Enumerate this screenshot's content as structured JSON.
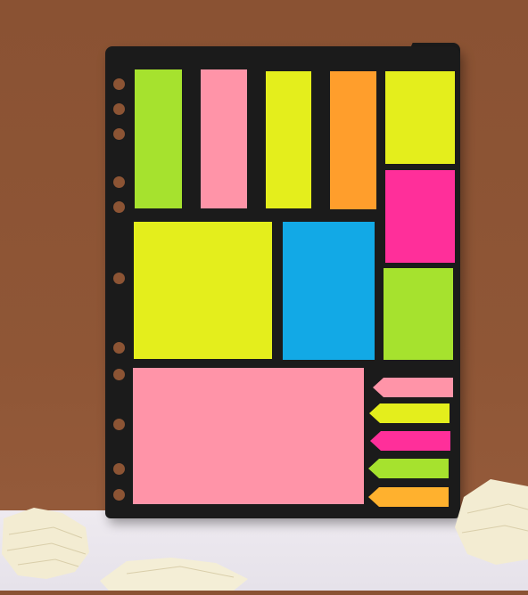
{
  "scene": {
    "subject": "sticky-notes-set",
    "colors": {
      "wall": "#8a5233",
      "table": "#ece8ee",
      "board": "#1b1b1b",
      "green": "#a6e22e",
      "pink": "#ff94a8",
      "yellow": "#e4ee1c",
      "orange": "#ff9e2c",
      "magenta": "#ff2f9a",
      "blue": "#12a9e6",
      "paper": "#f3ecd2"
    }
  }
}
